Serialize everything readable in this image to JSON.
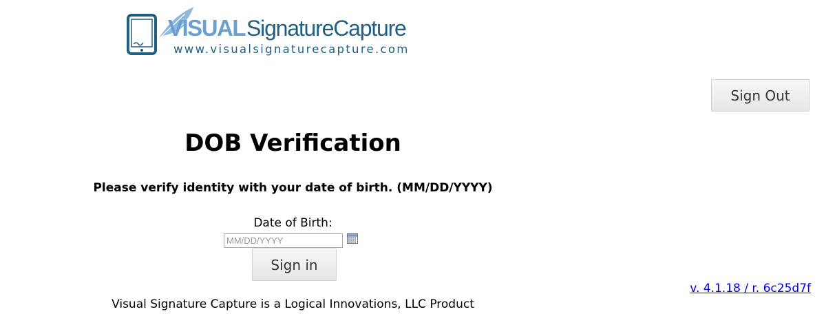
{
  "logo": {
    "brand_part1": "VISUAL",
    "brand_part2": "SignatureCapture",
    "url_text": "www.visualsignaturecapture.com",
    "colors": {
      "light_blue": "#6a9fcf",
      "dark_teal": "#1f5f82"
    },
    "icons": [
      "tablet-icon",
      "quill-icon"
    ]
  },
  "header": {
    "sign_out_label": "Sign Out"
  },
  "main": {
    "title": "DOB Verification",
    "instructions": "Please verify identity with your date of birth. (MM/DD/YYYY)",
    "dob_label": "Date of Birth:",
    "dob_input": {
      "value": "",
      "placeholder": "MM/DD/YYYY"
    },
    "calendar_icon": "calendar-icon",
    "sign_in_label": "Sign in"
  },
  "footer": {
    "product_text": "Visual Signature Capture is a Logical Innovations, LLC Product",
    "version_text": "v. 4.1.18 / r. 6c25d7f",
    "link_color": "#0000ee"
  }
}
